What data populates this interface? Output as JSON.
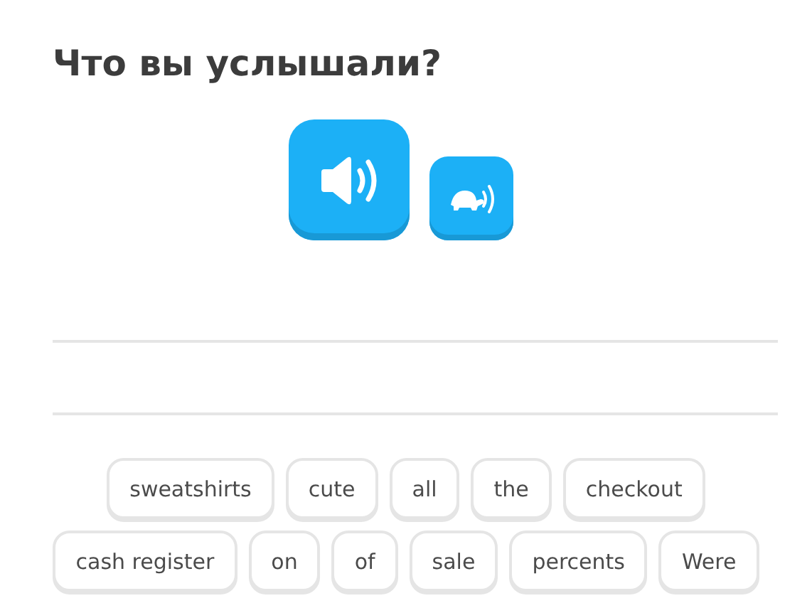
{
  "title": "Что вы услышали?",
  "audio_buttons": [
    {
      "kind": "normal"
    },
    {
      "kind": "slow"
    }
  ],
  "word_bank": [
    [
      "sweatshirts",
      "cute",
      "all",
      "the",
      "checkout"
    ],
    [
      "cash register",
      "on",
      "of",
      "sale",
      "percents",
      "Were"
    ]
  ]
}
